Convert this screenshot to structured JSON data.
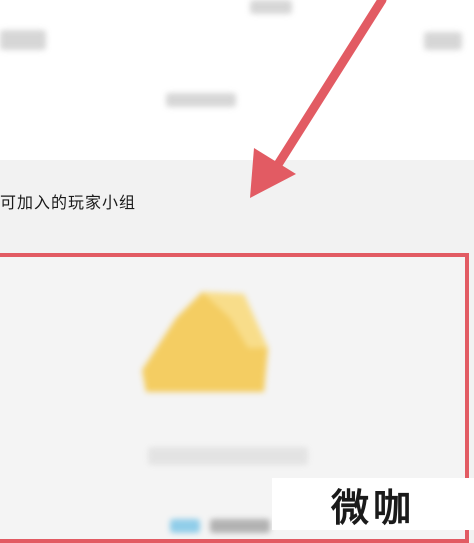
{
  "section": {
    "title": "可加入的玩家小组"
  },
  "watermark": {
    "text": "微咖"
  },
  "colors": {
    "arrow": "#e25b63",
    "highlight_border": "#e25b63",
    "icon": "#f4cd62",
    "page_background": "#f2f2f2"
  },
  "icons": {
    "group_icon": "yellow-triangle-group-icon"
  }
}
